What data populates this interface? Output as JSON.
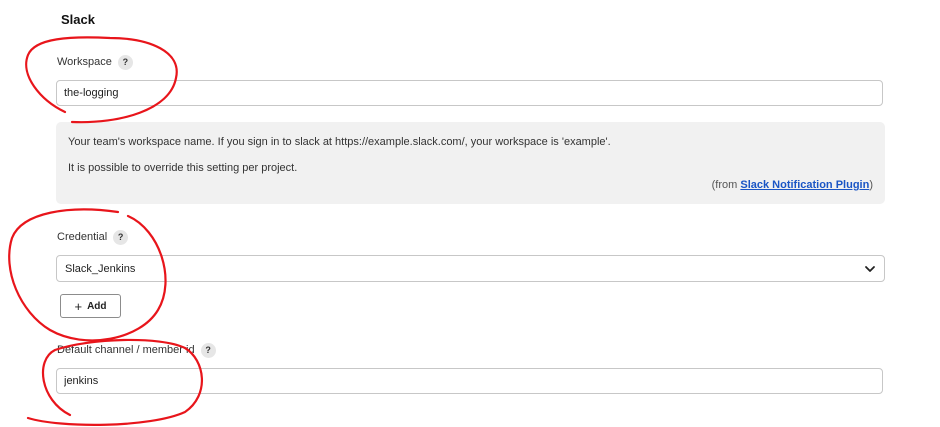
{
  "section": {
    "title": "Slack"
  },
  "workspace": {
    "label": "Workspace",
    "help_icon": "?",
    "value": "the-logging"
  },
  "workspace_help": {
    "line1": "Your team's workspace name. If you sign in to slack at https://example.slack.com/, your workspace is 'example'.",
    "line2": "It is possible to override this setting per project.",
    "from_prefix": "(from ",
    "plugin_link": "Slack Notification Plugin",
    "from_suffix": ")"
  },
  "credential": {
    "label": "Credential",
    "help_icon": "?",
    "selected": "Slack_Jenkins",
    "add_label": "Add",
    "add_icon": "+"
  },
  "channel": {
    "label": "Default channel / member id",
    "help_icon": "?",
    "value": "jenkins"
  },
  "icons": {
    "help": "question-mark-icon",
    "chevron": "chevron-down-icon",
    "add": "plus-icon"
  },
  "annotation_color": "#e8151b"
}
